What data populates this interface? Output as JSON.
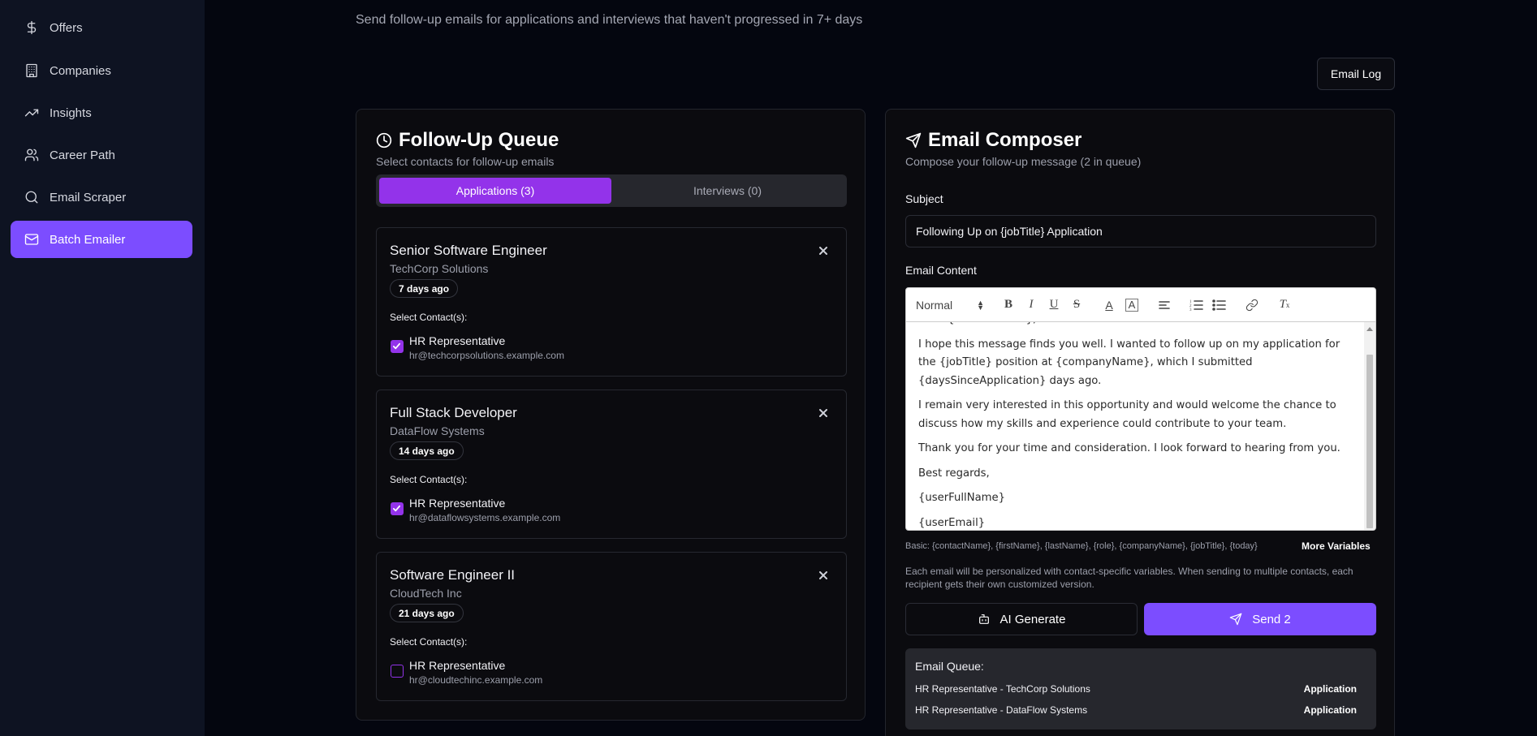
{
  "sidebar": {
    "items": [
      {
        "label": "Offers",
        "icon": "dollar-icon"
      },
      {
        "label": "Companies",
        "icon": "building-icon"
      },
      {
        "label": "Insights",
        "icon": "trending-up-icon"
      },
      {
        "label": "Career Path",
        "icon": "users-icon"
      },
      {
        "label": "Email Scraper",
        "icon": "search-icon"
      },
      {
        "label": "Batch Emailer",
        "icon": "mail-icon",
        "active": true
      }
    ]
  },
  "header": {
    "subtitle": "Send follow-up emails for applications and interviews that haven't progressed in 7+ days",
    "email_log_label": "Email Log"
  },
  "queue_panel": {
    "title": "Follow-Up Queue",
    "description": "Select contacts for follow-up emails",
    "tabs": [
      {
        "label": "Applications (3)",
        "active": true
      },
      {
        "label": "Interviews (0)",
        "active": false
      }
    ],
    "select_label": "Select Contact(s):",
    "jobs": [
      {
        "title": "Senior Software Engineer",
        "company": "TechCorp Solutions",
        "age": "7 days ago",
        "contact_name": "HR Representative",
        "contact_email": "hr@techcorpsolutions.example.com",
        "checked": true
      },
      {
        "title": "Full Stack Developer",
        "company": "DataFlow Systems",
        "age": "14 days ago",
        "contact_name": "HR Representative",
        "contact_email": "hr@dataflowsystems.example.com",
        "checked": true
      },
      {
        "title": "Software Engineer II",
        "company": "CloudTech Inc",
        "age": "21 days ago",
        "contact_name": "HR Representative",
        "contact_email": "hr@cloudtechinc.example.com",
        "checked": false
      }
    ]
  },
  "composer": {
    "title": "Email Composer",
    "description": "Compose your follow-up message (2 in queue)",
    "subject_label": "Subject",
    "subject_value": "Following Up on {jobTitle} Application",
    "content_label": "Email Content",
    "toolbar": {
      "format_value": "Normal"
    },
    "body": {
      "line0": "Dear {contactName},",
      "p1": "I hope this message finds you well. I wanted to follow up on my application for the {jobTitle} position at {companyName}, which I submitted {daysSinceApplication} days ago.",
      "p2": "I remain very interested in this opportunity and would welcome the chance to discuss how my skills and experience could contribute to your team.",
      "p3": "Thank you for your time and consideration. I look forward to hearing from you.",
      "p4": "Best regards,",
      "p5": "{userFullName}",
      "p6": "{userEmail}"
    },
    "variables_line": "Basic: {contactName}, {firstName}, {lastName}, {role}, {companyName}, {jobTitle}, {today}",
    "more_variables_label": "More Variables",
    "note": "Each email will be personalized with contact-specific variables. When sending to multiple contacts, each recipient gets their own customized version.",
    "ai_generate_label": "AI Generate",
    "send_label": "Send 2",
    "queue_title": "Email Queue:",
    "queue_items": [
      {
        "name": "HR Representative - TechCorp Solutions",
        "type": "Application"
      },
      {
        "name": "HR Representative - DataFlow Systems",
        "type": "Application"
      }
    ]
  },
  "colors": {
    "accent": "#7c4dff",
    "tab_active": "#9333ea",
    "background": "#04060f",
    "sidebar": "#0e1322"
  }
}
